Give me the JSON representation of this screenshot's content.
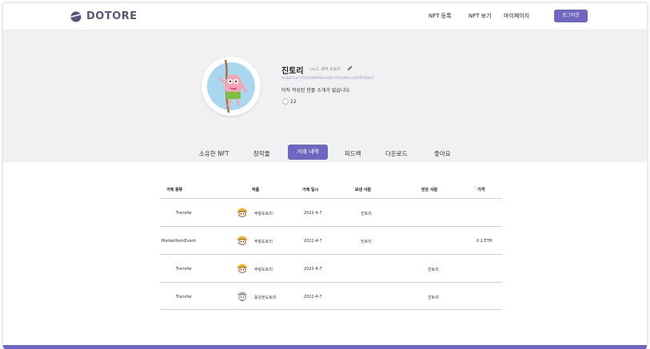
{
  "header": {
    "logo_text": "DOTORE",
    "nav": [
      "NFT 등록",
      "NFT 보기",
      "마이페이지"
    ],
    "logout_label": "로그아웃"
  },
  "profile": {
    "name": "진토리",
    "level": "Lv.2. 새싹 도토리",
    "address": "0x4bCCa77f20508990b4b0fc355a9f4Ac2f4f958847",
    "bio": "아직 작성된 한줄 소개가 없습니다.",
    "coins": "22"
  },
  "tabs": {
    "items": [
      "소유한 NFT",
      "창작물",
      "거래 내역",
      "피드백",
      "다운로드",
      "좋아요"
    ],
    "active_index": 2
  },
  "table": {
    "headers": [
      "거래 종류",
      "작품",
      "거래 일시",
      "보낸 사람",
      "받은 사람",
      "가격"
    ],
    "rows": [
      {
        "type": "Transfer",
        "nft": "주렁도토리",
        "date": "2022-4-7",
        "from": "진토리",
        "to": "",
        "price": "",
        "icon": "hardhat-acorn-icon"
      },
      {
        "type": "MarketItemEvent",
        "nft": "주렁도토리",
        "date": "2022-4-7",
        "from": "진토리",
        "to": "",
        "price": "0.2 ETH",
        "icon": "hardhat-acorn-icon"
      },
      {
        "type": "Transfer",
        "nft": "주렁도토리",
        "date": "2022-4-7",
        "from": "",
        "to": "진토리",
        "price": "",
        "icon": "hardhat-acorn-icon"
      },
      {
        "type": "Transfer",
        "nft": "동강한도토리",
        "date": "2022-4-7",
        "from": "",
        "to": "진토리",
        "price": "",
        "icon": "gray-acorn-icon"
      }
    ]
  },
  "colors": {
    "accent": "#6f66bf",
    "profile_bg": "#f1f1f3",
    "logo": "#5b5677"
  }
}
